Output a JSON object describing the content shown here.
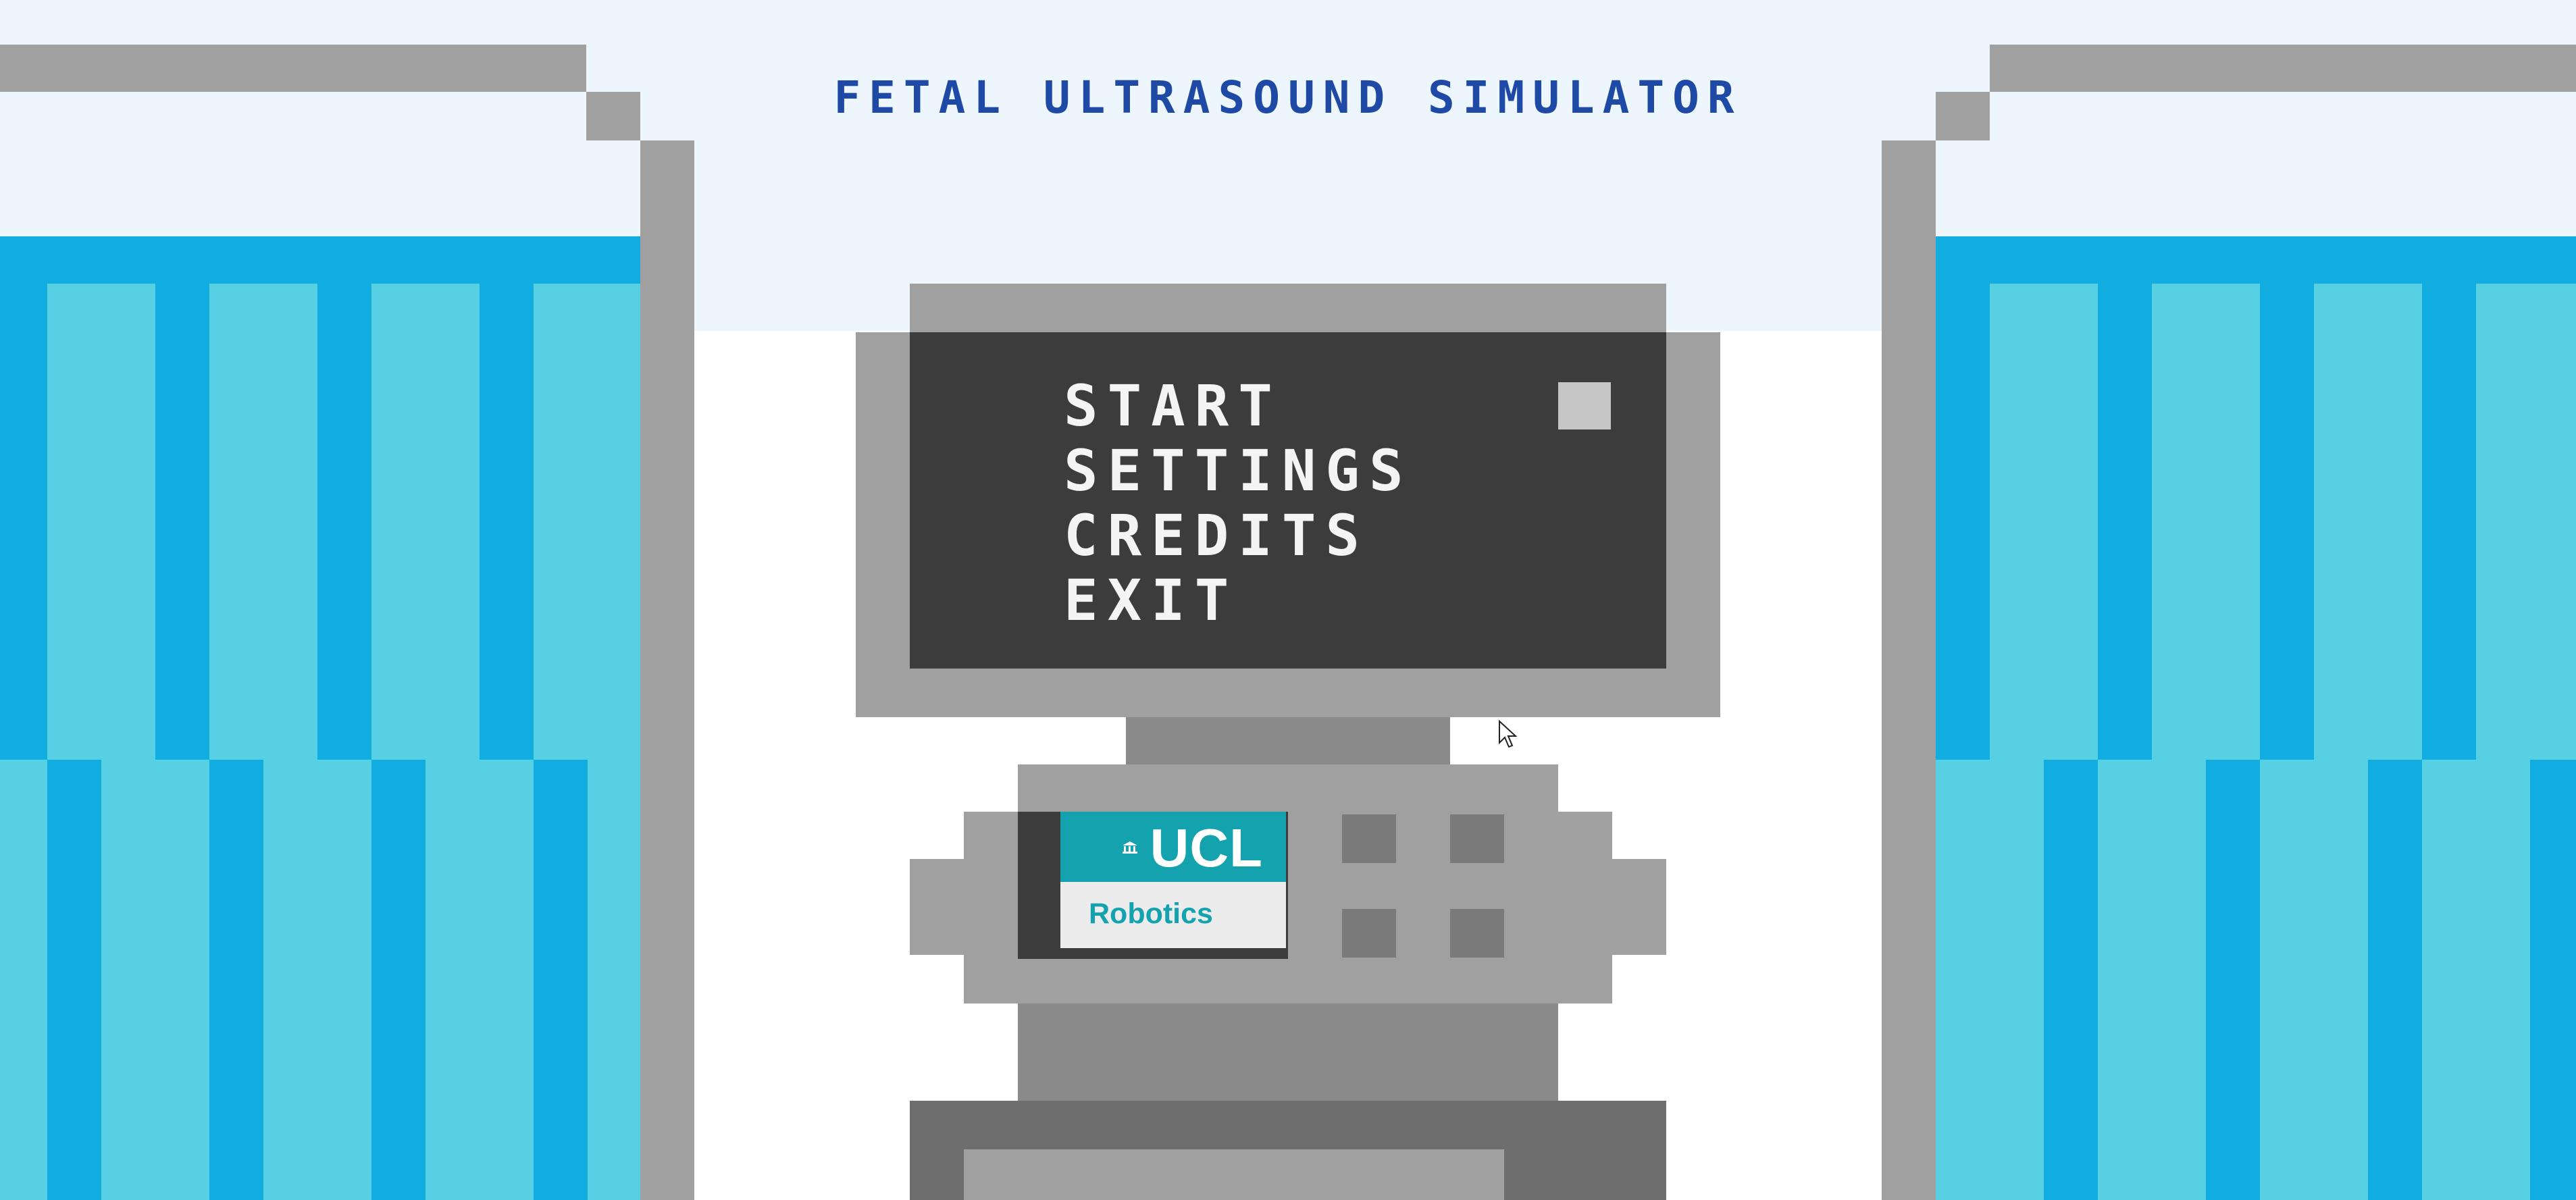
{
  "title": "FETAL ULTRASOUND SIMULATOR",
  "menu": {
    "items": [
      {
        "label": "START",
        "selected": true
      },
      {
        "label": "SETTINGS",
        "selected": false
      },
      {
        "label": "CREDITS",
        "selected": false
      },
      {
        "label": "EXIT",
        "selected": false
      }
    ]
  },
  "logo": {
    "brand": "UCL",
    "department": "Robotics"
  },
  "icons": {
    "selection_marker": "square-selector-icon",
    "cursor": "mouse-pointer-icon",
    "crest": "ucl-portico-icon"
  },
  "colors": {
    "title_text": "#1e4aa6",
    "sky": "#eef6fd",
    "curtain_dark": "#11ade0",
    "curtain_light": "#58d0e4",
    "frame_gray": "#a0a0a0",
    "screen_dark": "#3c3c3c",
    "menu_text": "#f4f4f4",
    "marker": "#c6c6c6",
    "logo_teal": "#13a2ae",
    "logo_light": "#ececec",
    "machine_mid": "#8a8a8a",
    "machine_dark": "#6e6e6e",
    "button_gray": "#7a7a7a"
  }
}
